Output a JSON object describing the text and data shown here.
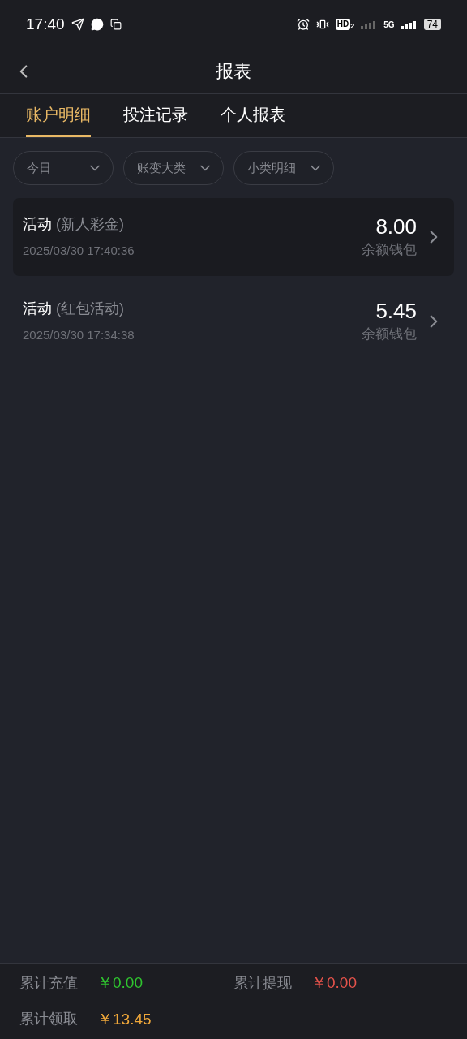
{
  "status_bar": {
    "time": "17:40",
    "hd": "HD",
    "hd_index": "2",
    "network": "5G",
    "battery": "74"
  },
  "header": {
    "title": "报表"
  },
  "tabs": [
    {
      "label": "账户明细",
      "selected": true
    },
    {
      "label": "投注记录",
      "selected": false
    },
    {
      "label": "个人报表",
      "selected": false
    }
  ],
  "filters": [
    {
      "label": "今日"
    },
    {
      "label": "账变大类"
    },
    {
      "label": "小类明细"
    }
  ],
  "records": [
    {
      "type": "活动",
      "detail": "(新人彩金)",
      "time": "2025/03/30 17:40:36",
      "amount": "8.00",
      "wallet": "余额钱包",
      "selected": true
    },
    {
      "type": "活动",
      "detail": "(红包活动)",
      "time": "2025/03/30 17:34:38",
      "amount": "5.45",
      "wallet": "余额钱包",
      "selected": false
    }
  ],
  "summary": [
    {
      "label": "累计充值",
      "value": "￥0.00",
      "color": "#2fc52f"
    },
    {
      "label": "累计提现",
      "value": "￥0.00",
      "color": "#e5534b"
    },
    {
      "label": "累计领取",
      "value": "￥13.45",
      "color": "#f0a83a"
    }
  ]
}
